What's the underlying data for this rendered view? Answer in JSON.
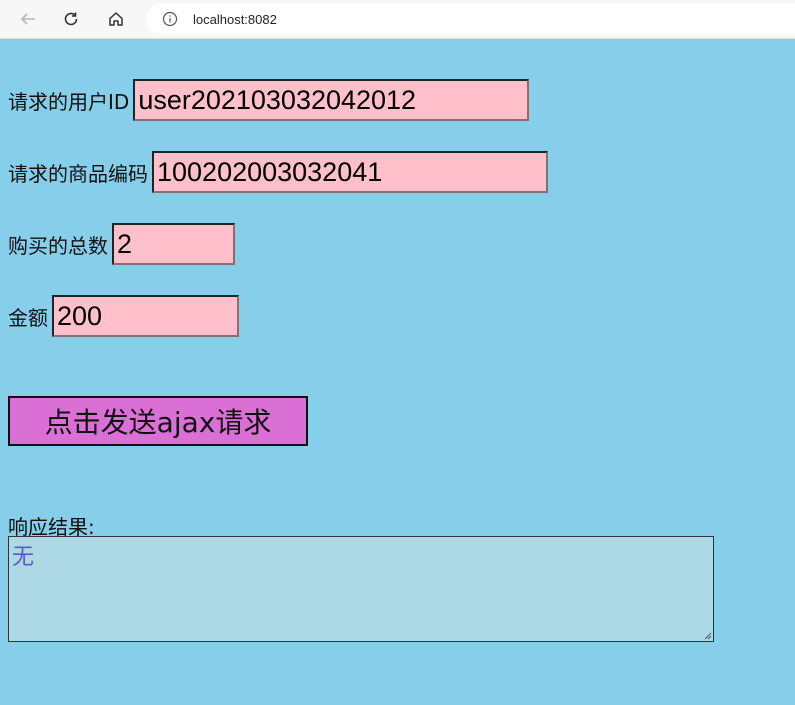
{
  "browser": {
    "url": "localhost:8082",
    "icons": [
      "back-arrow-icon",
      "reload-icon",
      "home-icon",
      "info-icon"
    ]
  },
  "form": {
    "user_id": {
      "label": "请求的用户ID",
      "value": "user202103032042012"
    },
    "product_code": {
      "label": "请求的商品编码",
      "value": "100202003032041"
    },
    "quantity": {
      "label": "购买的总数",
      "value": "2"
    },
    "amount": {
      "label": "金额",
      "value": "200"
    },
    "submit_label": "点击发送ajax请求"
  },
  "response": {
    "label": "响应结果:",
    "value": "无"
  },
  "colors": {
    "page_bg": "#87ceeb",
    "input_bg": "#ffc0cb",
    "button_bg": "#da70d6",
    "result_bg": "#add8e6",
    "result_text": "#5a5acd"
  }
}
